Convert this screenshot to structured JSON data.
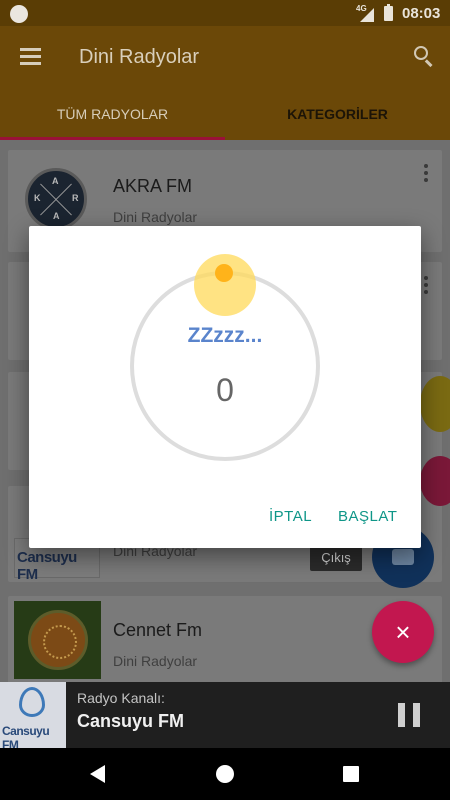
{
  "status_bar": {
    "network_label": "4G",
    "time": "08:03"
  },
  "app_bar": {
    "title": "Dini Radyolar",
    "menu_icon": "menu-icon",
    "search_icon": "search-icon"
  },
  "tabs": [
    {
      "label": "TÜM RADYOLAR",
      "selected": true
    },
    {
      "label": "KATEGORİLER",
      "selected": false
    }
  ],
  "stations": [
    {
      "name": "AKRA FM",
      "category": "Dini Radyolar",
      "logo_letters": [
        "A",
        "K",
        "R",
        "A"
      ]
    },
    {
      "name": "",
      "category": "Dini Radyolar",
      "logo_text": "Cansuyu FM"
    },
    {
      "name": "Cennet Fm",
      "category": "Dini Radyolar"
    }
  ],
  "exit_chip": "Çıkış",
  "sleep_dialog": {
    "label": "ZZzzz...",
    "value": "0",
    "cancel_label": "İPTAL",
    "start_label": "BAŞLAT",
    "accent_color": "#0f9688",
    "label_color": "#5a84cc",
    "knob_color": "#ffb31a"
  },
  "player": {
    "label": "Radyo Kanalı:",
    "station": "Cansuyu FM",
    "art_text": "Cansuyu FM",
    "pause_icon": "pause-icon"
  },
  "fab": {
    "close_symbol": "×"
  }
}
